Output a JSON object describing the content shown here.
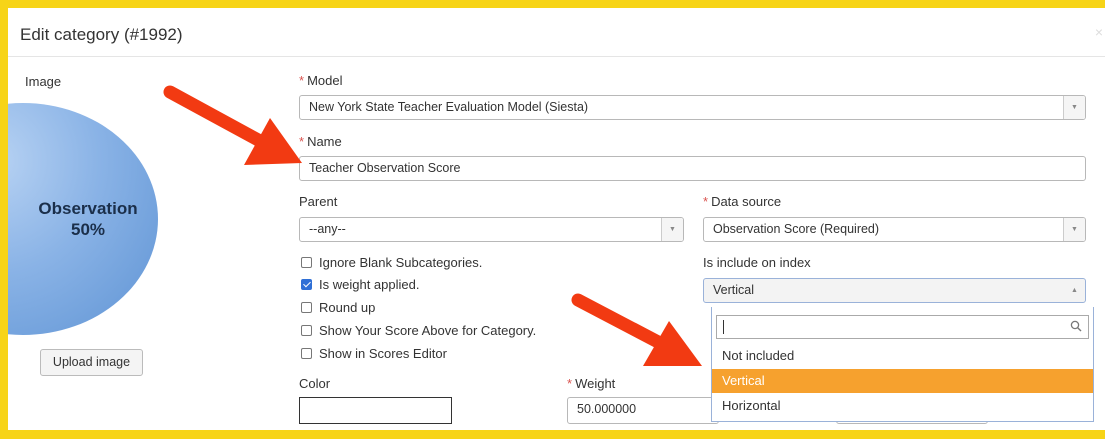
{
  "dialog": {
    "title": "Edit category (#1992)",
    "close": "×"
  },
  "image": {
    "label": "Image",
    "pie_line1": "Observation",
    "pie_line2": "50%",
    "upload_label": "Upload image"
  },
  "model": {
    "label": "Model",
    "value": "New York State Teacher Evaluation Model (Siesta)"
  },
  "name": {
    "label": "Name",
    "value": "Teacher Observation Score"
  },
  "parent": {
    "label": "Parent",
    "value": "--any--"
  },
  "data_source": {
    "label": "Data source",
    "value": "Observation Score (Required)"
  },
  "checkboxes": [
    {
      "label": "Ignore Blank Subcategories.",
      "checked": false
    },
    {
      "label": "Is weight applied.",
      "checked": true
    },
    {
      "label": "Round up",
      "checked": false
    },
    {
      "label": "Show Your Score Above for Category.",
      "checked": false
    },
    {
      "label": "Show in Scores Editor",
      "checked": false
    }
  ],
  "include_on_index": {
    "label": "Is include on index",
    "selected": "Vertical",
    "search_value": "",
    "options": [
      "Not included",
      "Vertical",
      "Horizontal"
    ],
    "highlighted": "Vertical"
  },
  "color": {
    "label": "Color",
    "value": ""
  },
  "weight": {
    "label": "Weight",
    "value": "50.000000"
  },
  "required_marker": "*",
  "colors": {
    "highlight": "#f6a12e",
    "frame": "#f7d417",
    "annotation_arrow": "#f23a12",
    "required": "#d9534f"
  }
}
